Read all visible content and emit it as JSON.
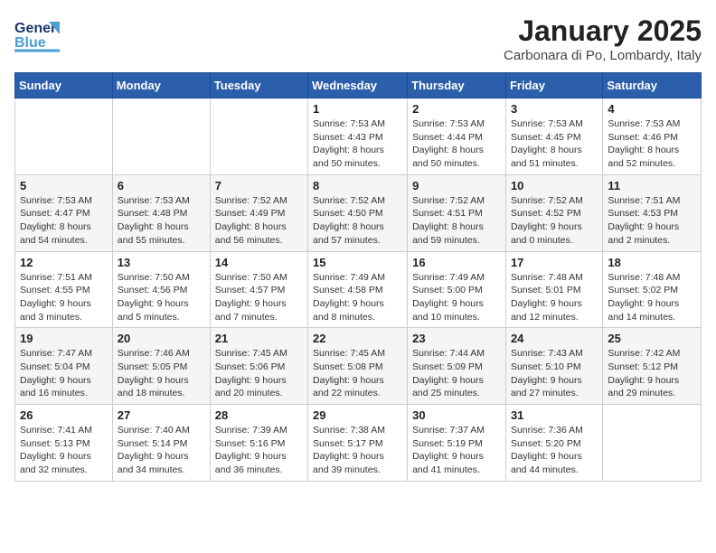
{
  "logo": {
    "text_general": "General",
    "text_blue": "Blue"
  },
  "header": {
    "month_title": "January 2025",
    "location": "Carbonara di Po, Lombardy, Italy"
  },
  "weekdays": [
    "Sunday",
    "Monday",
    "Tuesday",
    "Wednesday",
    "Thursday",
    "Friday",
    "Saturday"
  ],
  "weeks": [
    [
      {
        "day": "",
        "sunrise": "",
        "sunset": "",
        "daylight": ""
      },
      {
        "day": "",
        "sunrise": "",
        "sunset": "",
        "daylight": ""
      },
      {
        "day": "",
        "sunrise": "",
        "sunset": "",
        "daylight": ""
      },
      {
        "day": "1",
        "sunrise": "Sunrise: 7:53 AM",
        "sunset": "Sunset: 4:43 PM",
        "daylight": "Daylight: 8 hours and 50 minutes."
      },
      {
        "day": "2",
        "sunrise": "Sunrise: 7:53 AM",
        "sunset": "Sunset: 4:44 PM",
        "daylight": "Daylight: 8 hours and 50 minutes."
      },
      {
        "day": "3",
        "sunrise": "Sunrise: 7:53 AM",
        "sunset": "Sunset: 4:45 PM",
        "daylight": "Daylight: 8 hours and 51 minutes."
      },
      {
        "day": "4",
        "sunrise": "Sunrise: 7:53 AM",
        "sunset": "Sunset: 4:46 PM",
        "daylight": "Daylight: 8 hours and 52 minutes."
      }
    ],
    [
      {
        "day": "5",
        "sunrise": "Sunrise: 7:53 AM",
        "sunset": "Sunset: 4:47 PM",
        "daylight": "Daylight: 8 hours and 54 minutes."
      },
      {
        "day": "6",
        "sunrise": "Sunrise: 7:53 AM",
        "sunset": "Sunset: 4:48 PM",
        "daylight": "Daylight: 8 hours and 55 minutes."
      },
      {
        "day": "7",
        "sunrise": "Sunrise: 7:52 AM",
        "sunset": "Sunset: 4:49 PM",
        "daylight": "Daylight: 8 hours and 56 minutes."
      },
      {
        "day": "8",
        "sunrise": "Sunrise: 7:52 AM",
        "sunset": "Sunset: 4:50 PM",
        "daylight": "Daylight: 8 hours and 57 minutes."
      },
      {
        "day": "9",
        "sunrise": "Sunrise: 7:52 AM",
        "sunset": "Sunset: 4:51 PM",
        "daylight": "Daylight: 8 hours and 59 minutes."
      },
      {
        "day": "10",
        "sunrise": "Sunrise: 7:52 AM",
        "sunset": "Sunset: 4:52 PM",
        "daylight": "Daylight: 9 hours and 0 minutes."
      },
      {
        "day": "11",
        "sunrise": "Sunrise: 7:51 AM",
        "sunset": "Sunset: 4:53 PM",
        "daylight": "Daylight: 9 hours and 2 minutes."
      }
    ],
    [
      {
        "day": "12",
        "sunrise": "Sunrise: 7:51 AM",
        "sunset": "Sunset: 4:55 PM",
        "daylight": "Daylight: 9 hours and 3 minutes."
      },
      {
        "day": "13",
        "sunrise": "Sunrise: 7:50 AM",
        "sunset": "Sunset: 4:56 PM",
        "daylight": "Daylight: 9 hours and 5 minutes."
      },
      {
        "day": "14",
        "sunrise": "Sunrise: 7:50 AM",
        "sunset": "Sunset: 4:57 PM",
        "daylight": "Daylight: 9 hours and 7 minutes."
      },
      {
        "day": "15",
        "sunrise": "Sunrise: 7:49 AM",
        "sunset": "Sunset: 4:58 PM",
        "daylight": "Daylight: 9 hours and 8 minutes."
      },
      {
        "day": "16",
        "sunrise": "Sunrise: 7:49 AM",
        "sunset": "Sunset: 5:00 PM",
        "daylight": "Daylight: 9 hours and 10 minutes."
      },
      {
        "day": "17",
        "sunrise": "Sunrise: 7:48 AM",
        "sunset": "Sunset: 5:01 PM",
        "daylight": "Daylight: 9 hours and 12 minutes."
      },
      {
        "day": "18",
        "sunrise": "Sunrise: 7:48 AM",
        "sunset": "Sunset: 5:02 PM",
        "daylight": "Daylight: 9 hours and 14 minutes."
      }
    ],
    [
      {
        "day": "19",
        "sunrise": "Sunrise: 7:47 AM",
        "sunset": "Sunset: 5:04 PM",
        "daylight": "Daylight: 9 hours and 16 minutes."
      },
      {
        "day": "20",
        "sunrise": "Sunrise: 7:46 AM",
        "sunset": "Sunset: 5:05 PM",
        "daylight": "Daylight: 9 hours and 18 minutes."
      },
      {
        "day": "21",
        "sunrise": "Sunrise: 7:45 AM",
        "sunset": "Sunset: 5:06 PM",
        "daylight": "Daylight: 9 hours and 20 minutes."
      },
      {
        "day": "22",
        "sunrise": "Sunrise: 7:45 AM",
        "sunset": "Sunset: 5:08 PM",
        "daylight": "Daylight: 9 hours and 22 minutes."
      },
      {
        "day": "23",
        "sunrise": "Sunrise: 7:44 AM",
        "sunset": "Sunset: 5:09 PM",
        "daylight": "Daylight: 9 hours and 25 minutes."
      },
      {
        "day": "24",
        "sunrise": "Sunrise: 7:43 AM",
        "sunset": "Sunset: 5:10 PM",
        "daylight": "Daylight: 9 hours and 27 minutes."
      },
      {
        "day": "25",
        "sunrise": "Sunrise: 7:42 AM",
        "sunset": "Sunset: 5:12 PM",
        "daylight": "Daylight: 9 hours and 29 minutes."
      }
    ],
    [
      {
        "day": "26",
        "sunrise": "Sunrise: 7:41 AM",
        "sunset": "Sunset: 5:13 PM",
        "daylight": "Daylight: 9 hours and 32 minutes."
      },
      {
        "day": "27",
        "sunrise": "Sunrise: 7:40 AM",
        "sunset": "Sunset: 5:14 PM",
        "daylight": "Daylight: 9 hours and 34 minutes."
      },
      {
        "day": "28",
        "sunrise": "Sunrise: 7:39 AM",
        "sunset": "Sunset: 5:16 PM",
        "daylight": "Daylight: 9 hours and 36 minutes."
      },
      {
        "day": "29",
        "sunrise": "Sunrise: 7:38 AM",
        "sunset": "Sunset: 5:17 PM",
        "daylight": "Daylight: 9 hours and 39 minutes."
      },
      {
        "day": "30",
        "sunrise": "Sunrise: 7:37 AM",
        "sunset": "Sunset: 5:19 PM",
        "daylight": "Daylight: 9 hours and 41 minutes."
      },
      {
        "day": "31",
        "sunrise": "Sunrise: 7:36 AM",
        "sunset": "Sunset: 5:20 PM",
        "daylight": "Daylight: 9 hours and 44 minutes."
      },
      {
        "day": "",
        "sunrise": "",
        "sunset": "",
        "daylight": ""
      }
    ]
  ]
}
